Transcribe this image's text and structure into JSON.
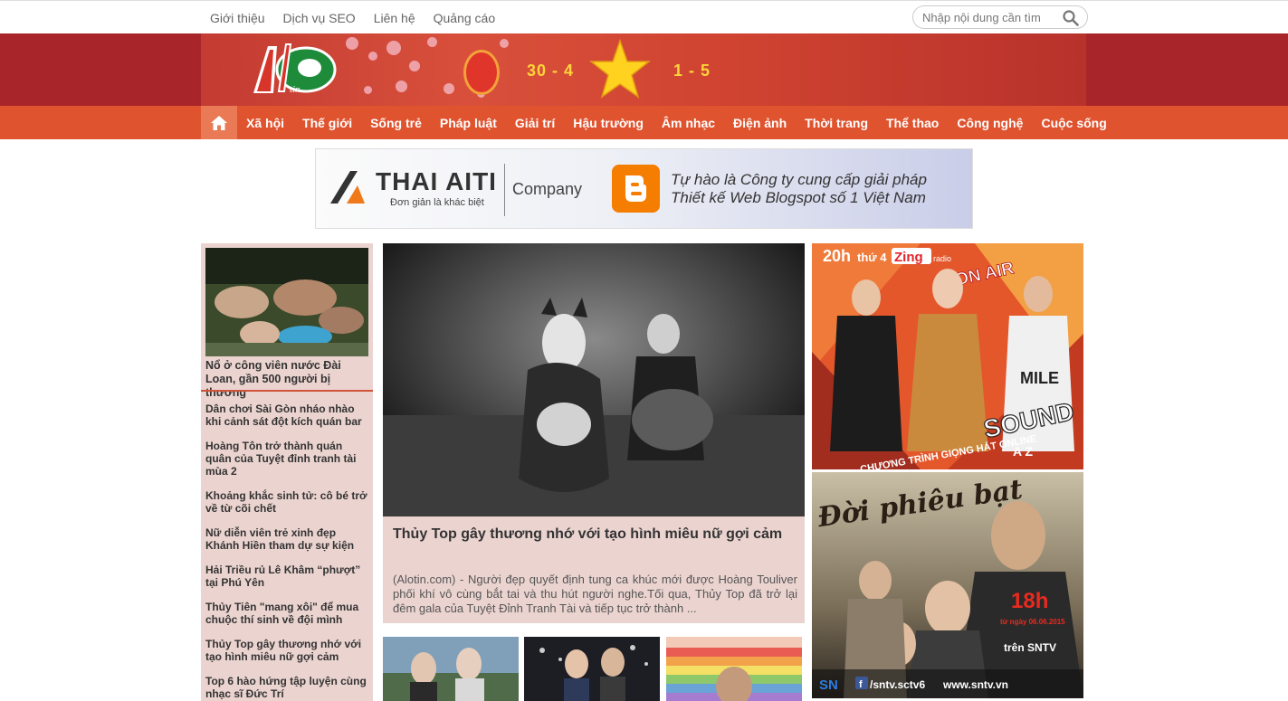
{
  "topbar": {
    "links": [
      "Giới thiệu",
      "Dịch vụ SEO",
      "Liên hệ",
      "Quảng cáo"
    ],
    "search_placeholder": "Nhập nội dung cần tìm"
  },
  "banner": {
    "logo_text": "Alo tin",
    "date_left": "30 - 4",
    "date_right": "1 - 5"
  },
  "nav": {
    "items": [
      "Xã hội",
      "Thế giới",
      "Sống trẻ",
      "Pháp luật",
      "Giải trí",
      "Hậu trường",
      "Âm nhạc",
      "Điện ảnh",
      "Thời trang",
      "Thể thao",
      "Công nghệ",
      "Cuộc sống"
    ]
  },
  "ad_top": {
    "brand": "THAI AITI",
    "slogan": "Đơn giản là khác biệt",
    "company": "Company",
    "line1": "Tự hào là Công ty cung cấp giải pháp",
    "line2": "Thiết kế Web Blogspot số 1 Việt Nam"
  },
  "left": {
    "lead_title": "Nổ ở công viên nước Đài Loan, gần 500 người bị thương",
    "items": [
      "Dân chơi Sài Gòn nháo nhào khi cảnh sát đột kích quán bar",
      "Hoàng Tôn trở thành quán quân của Tuyệt đỉnh tranh tài mùa 2",
      "Khoảng khắc sinh tử: cô bé trở về từ cõi chết",
      "Nữ diễn viên trẻ xinh đẹp Khánh Hiền tham dự sự kiện",
      "Hải Triều rủ Lê Khâm “phượt” tại Phú Yên",
      "Thủy Tiên \"mang xôi\" để mua chuộc thí sinh về đội mình",
      "Thủy Top gây thương nhớ với tạo hình miêu nữ gợi cảm",
      "Top 6 hào hứng tập luyện cùng nhạc sĩ Đức Trí"
    ]
  },
  "feature": {
    "title": "Thủy Top gây thương nhớ với tạo hình miêu nữ gợi cảm",
    "desc": "(Alotin.com) - Người đẹp quyết định tung ca khúc mới được Hoàng Touliver phối khí vô cùng bắt tai và thu hút người nghe.Tối qua, Thủy Top đã trở lại đêm gala của Tuyệt Đỉnh Tranh Tài và tiếp tục trở thành ..."
  },
  "ad_right1": {
    "time": "20h",
    "day": "thứ 4",
    "brand": "Zing",
    "brand_sub": "radio",
    "on_air": "ON AIR",
    "program": "CHƯƠNG TRÌNH GIỌNG HÁT ONLINE",
    "name_big": "SOUND",
    "name_small": "A Z",
    "shirt": "MILE"
  },
  "ad_right2": {
    "title": "Đời phiêu bạt",
    "time": "18h",
    "date_label": "từ ngày 06.06.2015",
    "channel": "trên SNTV",
    "logo": "SN",
    "fb": "/sntv.sctv6",
    "site": "www.sntv.vn"
  },
  "colors": {
    "nav_bg": "#e0532f",
    "banner_bg": "#a8262a",
    "panel_bg": "#ebd4d0",
    "accent": "#d0533a"
  }
}
